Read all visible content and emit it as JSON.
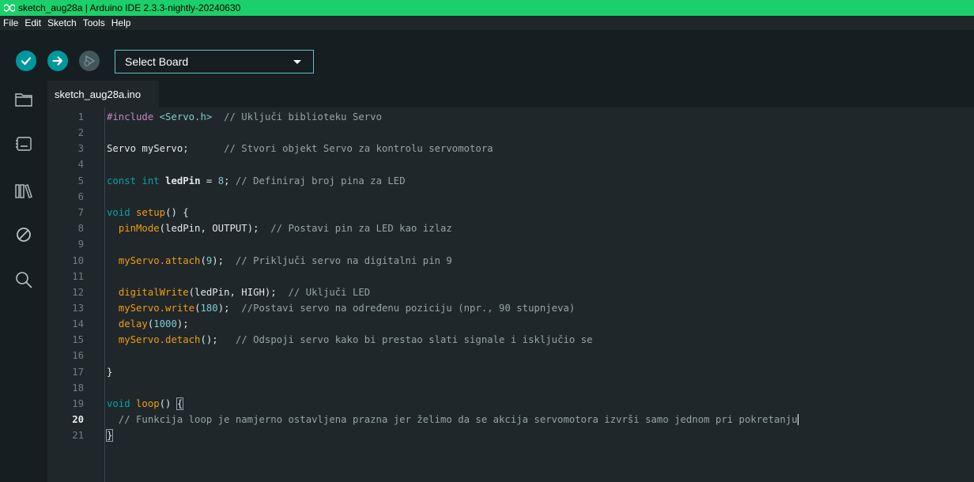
{
  "window": {
    "title": "sketch_aug28a | Arduino IDE 2.3.3-nightly-20240630"
  },
  "menu": [
    "File",
    "Edit",
    "Sketch",
    "Tools",
    "Help"
  ],
  "toolbar": {
    "board_select": "Select Board"
  },
  "tab": {
    "label": "sketch_aug28a.ino"
  },
  "editor": {
    "active_line": 20,
    "lines": [
      {
        "n": "1"
      },
      {
        "n": "2"
      },
      {
        "n": "3"
      },
      {
        "n": "4"
      },
      {
        "n": "5"
      },
      {
        "n": "6"
      },
      {
        "n": "7"
      },
      {
        "n": "8"
      },
      {
        "n": "9"
      },
      {
        "n": "10"
      },
      {
        "n": "11"
      },
      {
        "n": "12"
      },
      {
        "n": "13"
      },
      {
        "n": "14"
      },
      {
        "n": "15"
      },
      {
        "n": "16"
      },
      {
        "n": "17"
      },
      {
        "n": "18"
      },
      {
        "n": "19"
      },
      {
        "n": "20"
      },
      {
        "n": "21"
      }
    ],
    "code": {
      "l1_a": "#include ",
      "l1_b": "<Servo.h>",
      "l1_c": "  // Uključi biblioteku Servo",
      "l3_a": "Servo myServo;",
      "l3_c": "      // Stvori objekt Servo za kontrolu servomotora",
      "l5_a": "const int ",
      "l5_b": "ledPin",
      "l5_c": " = ",
      "l5_d": "8",
      "l5_e": "; ",
      "l5_f": "// Definiraj broj pina za LED",
      "l7_a": "void ",
      "l7_b": "setup",
      "l7_c": "() {",
      "l8_a": "  ",
      "l8_b": "pinMode",
      "l8_c": "(ledPin, OUTPUT);",
      "l8_d": "  // Postavi pin za LED kao izlaz",
      "l10_a": "  ",
      "l10_b": "myServo.attach",
      "l10_c": "(",
      "l10_d": "9",
      "l10_e": ");",
      "l10_f": "  // Priključi servo na digitalni pin 9",
      "l12_a": "  ",
      "l12_b": "digitalWrite",
      "l12_c": "(ledPin, HIGH);",
      "l12_d": "  // Uključi LED",
      "l13_a": "  ",
      "l13_b": "myServo.write",
      "l13_c": "(",
      "l13_d": "180",
      "l13_e": ");",
      "l13_f": "  //Postavi servo na određenu poziciju (npr., 90 stupnjeva)",
      "l14_a": "  ",
      "l14_b": "delay",
      "l14_c": "(",
      "l14_d": "1000",
      "l14_e": ");",
      "l15_a": "  ",
      "l15_b": "myServo.detach",
      "l15_c": "();",
      "l15_d": "   // Odspoji servo kako bi prestao slati signale i isključio se",
      "l17_a": "}",
      "l19_a": "void ",
      "l19_b": "loop",
      "l19_c": "() ",
      "l19_d": "{",
      "l20_a": "  // Funkcija loop je namjerno ostavljena prazna jer želimo da se akcija servomotora izvrši samo jednom pri pokretanju",
      "l21_a": "}"
    }
  },
  "colors": {
    "titlebar": "#1bd06a",
    "accent": "#00979d",
    "keyword": "#0ca1a6",
    "function": "#f39c12",
    "comment": "#95a5a6"
  },
  "icons": {
    "verify": "check-icon",
    "upload": "arrow-right-icon",
    "debug": "debug-icon",
    "sidebar": [
      "folder-icon",
      "boards-icon",
      "library-icon",
      "debug-disabled-icon",
      "search-icon"
    ]
  }
}
